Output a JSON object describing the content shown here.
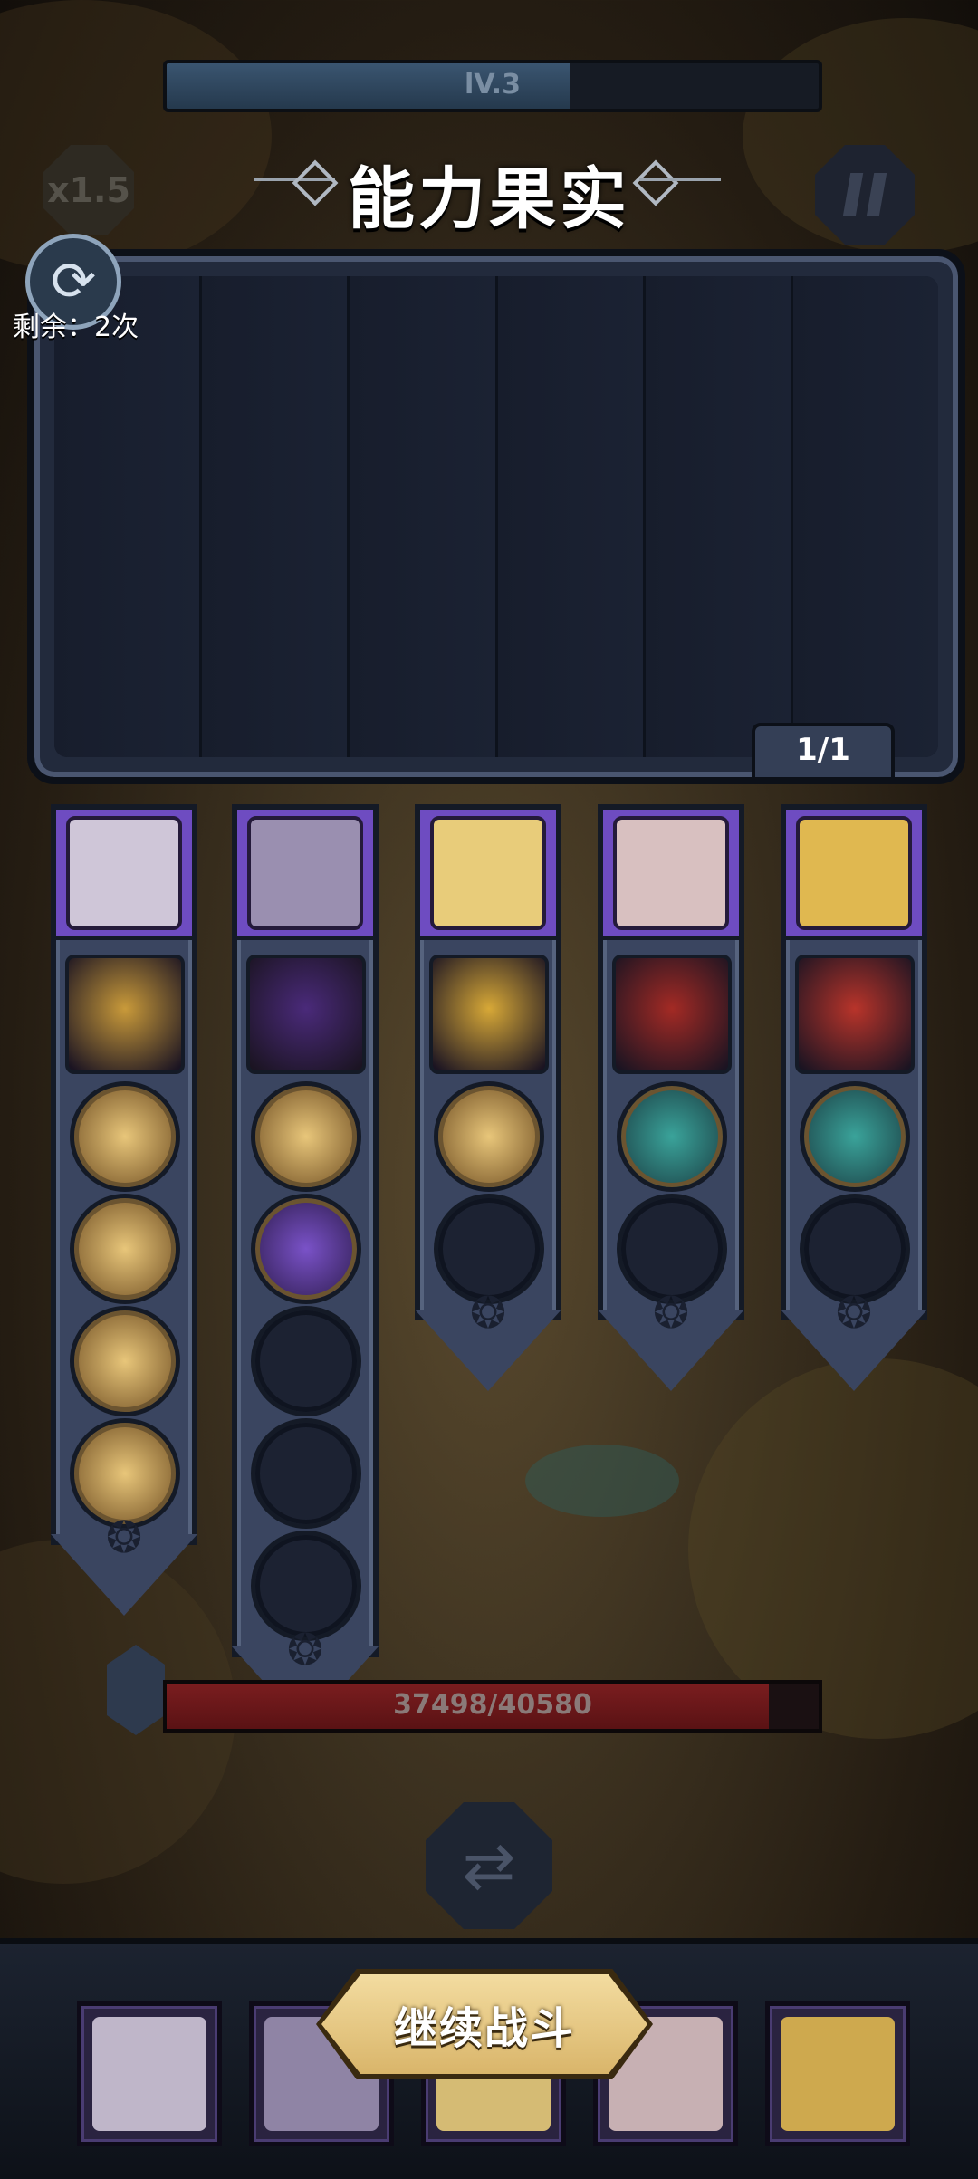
{
  "top": {
    "level_text": "lV.3",
    "speed_text": "x1.5",
    "title": "能力果实",
    "refresh_remaining": "剩余：2次"
  },
  "panel": {
    "page_indicator": "1/1"
  },
  "hero_columns": [
    {
      "name": "hero-1",
      "portrait_color": "#cfc6d8",
      "skill_color": "#c99a3a",
      "filled_slots": 4,
      "empty_slots": 0
    },
    {
      "name": "hero-2",
      "portrait_color": "#9a8fb0",
      "skill_color": "#4a2a7a",
      "filled_slots": 2,
      "empty_slots": 3
    },
    {
      "name": "hero-3",
      "portrait_color": "#e8cc7a",
      "skill_color": "#d7a837",
      "filled_slots": 1,
      "empty_slots": 1
    },
    {
      "name": "hero-4",
      "portrait_color": "#d8c0c0",
      "skill_color": "#a32a24",
      "filled_slots": 1,
      "empty_slots": 1
    },
    {
      "name": "hero-5",
      "portrait_color": "#e0b850",
      "skill_color": "#b8342a",
      "filled_slots": 1,
      "empty_slots": 1
    }
  ],
  "boss_hp": {
    "text": "37498/40580",
    "fraction": 0.924
  },
  "level_progress": 0.62,
  "bottom": {
    "continue_label": "继续战斗"
  },
  "colors": {
    "gold": "#d9b56a",
    "panel": "#222a3c",
    "hero_frame": "#6e4cc1"
  }
}
